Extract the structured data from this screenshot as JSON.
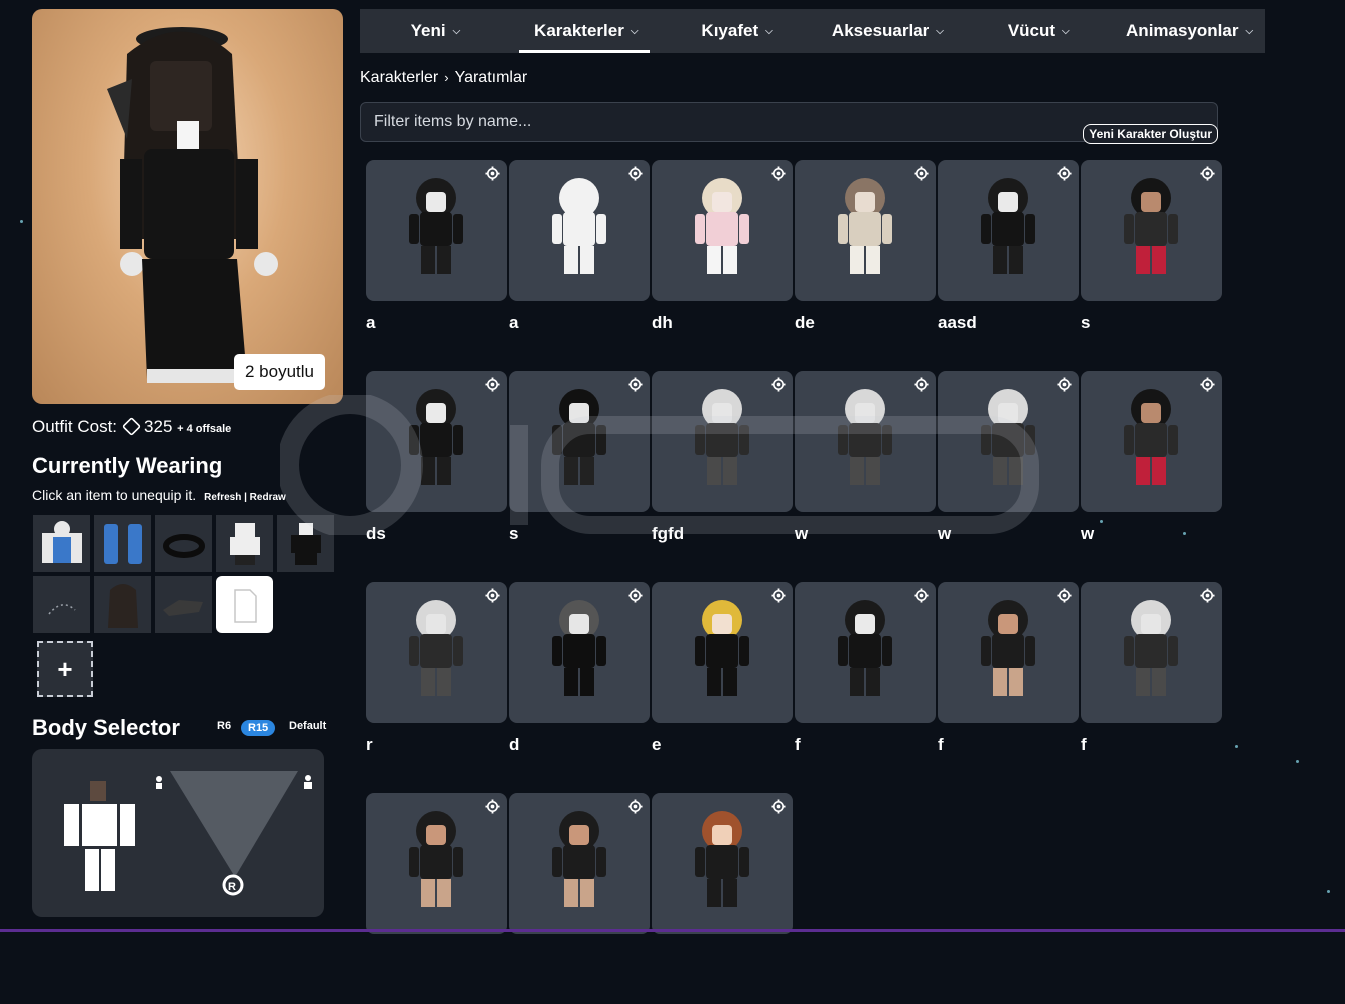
{
  "nav": [
    {
      "label": "Yeni",
      "active": false
    },
    {
      "label": "Karakterler",
      "active": true
    },
    {
      "label": "Kıyafet",
      "active": false
    },
    {
      "label": "Aksesuarlar",
      "active": false
    },
    {
      "label": "Vücut",
      "active": false
    },
    {
      "label": "Animasyonlar",
      "active": false
    }
  ],
  "breadcrumb": {
    "parent": "Karakterler",
    "sep": "›",
    "current": "Yaratımlar"
  },
  "filter": {
    "placeholder": "Filter items by name..."
  },
  "new_character_label": "Yeni Karakter Oluştur",
  "avatar": {
    "dimension_button": "2 boyutlu"
  },
  "outfit_cost": {
    "label": "Outfit Cost:",
    "value": "325",
    "extra": "+ 4 offsale"
  },
  "currently_wearing": {
    "title": "Currently Wearing",
    "hint": "Click an item to unequip it.",
    "links": "Refresh | Redraw"
  },
  "body_selector": {
    "title": "Body Selector",
    "r6": "R6",
    "r15": "R15",
    "default": "Default"
  },
  "characters": [
    {
      "name": "a",
      "look": "dark"
    },
    {
      "name": "a",
      "look": "blocky"
    },
    {
      "name": "dh",
      "look": "pink"
    },
    {
      "name": "de",
      "look": "beige"
    },
    {
      "name": "aasd",
      "look": "dark"
    },
    {
      "name": "s",
      "look": "red"
    },
    {
      "name": "ds",
      "look": "dark"
    },
    {
      "name": "s",
      "look": "hat"
    },
    {
      "name": "fgfd",
      "look": "white"
    },
    {
      "name": "w",
      "look": "white"
    },
    {
      "name": "w",
      "look": "white"
    },
    {
      "name": "w",
      "look": "red"
    },
    {
      "name": "r",
      "look": "white"
    },
    {
      "name": "d",
      "look": "blackshirt"
    },
    {
      "name": "e",
      "look": "blonde"
    },
    {
      "name": "f",
      "look": "dark"
    },
    {
      "name": "f",
      "look": "tan"
    },
    {
      "name": "f",
      "look": "white"
    },
    {
      "name": "",
      "look": "tan"
    },
    {
      "name": "",
      "look": "tan"
    },
    {
      "name": "",
      "look": "ginger"
    }
  ],
  "worn_items": [
    "head",
    "arms",
    "ring",
    "avatar",
    "avatar",
    "pants",
    "hair",
    "hair",
    "item",
    "blank"
  ],
  "colors": {
    "bg": "#0b1018",
    "panel": "#2a2f37",
    "card": "#3b424d",
    "accent": "#2b86e0"
  }
}
